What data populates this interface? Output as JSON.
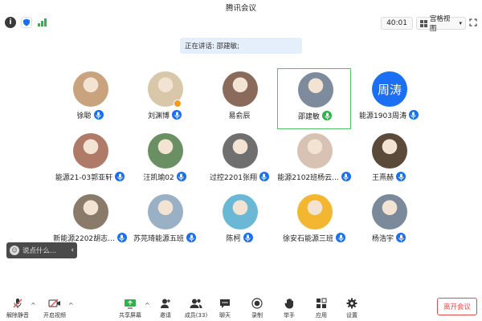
{
  "window": {
    "title": "腾讯会议"
  },
  "toolbar_top": {
    "timer": "40:01",
    "view_label": "宫格视图"
  },
  "speaking": {
    "label": "正在讲话: 邵建敏;"
  },
  "participants": [
    {
      "name": "徐聪",
      "avatar": "photo",
      "color": "#c9a37e",
      "mic": "on"
    },
    {
      "name": "刘渊博",
      "avatar": "photo",
      "color": "#d8c7a8",
      "mic": "on"
    },
    {
      "name": "易俞辰",
      "avatar": "photo",
      "color": "#8a6a5a",
      "mic": "none"
    },
    {
      "name": "邵建敏",
      "avatar": "photo",
      "color": "#7d8b9c",
      "mic": "speaking"
    },
    {
      "name": "能源1903周涛",
      "avatar": "text",
      "avatar_text": "周涛",
      "mic": "on"
    },
    {
      "name": "能源21-03郭亚轩",
      "avatar": "photo",
      "color": "#b07a68",
      "mic": "on"
    },
    {
      "name": "汪凯瑜02",
      "avatar": "photo",
      "color": "#6a8f63",
      "mic": "on"
    },
    {
      "name": "过控2201张翔",
      "avatar": "photo",
      "color": "#6f6f6f",
      "mic": "on"
    },
    {
      "name": "能源2102班杨云...",
      "avatar": "photo",
      "color": "#d7c2b4",
      "mic": "on"
    },
    {
      "name": "王熹赫",
      "avatar": "photo",
      "color": "#5b4a3a",
      "mic": "on"
    },
    {
      "name": "新能源2202胡志...",
      "avatar": "photo",
      "color": "#8a7a6a",
      "mic": "on"
    },
    {
      "name": "苏芫琦能源五班",
      "avatar": "photo",
      "color": "#9ab0c4",
      "mic": "on"
    },
    {
      "name": "陈柯",
      "avatar": "photo",
      "color": "#6ab8d6",
      "mic": "on"
    },
    {
      "name": "徐安石能源三班",
      "avatar": "photo",
      "color": "#f2b630",
      "mic": "on"
    },
    {
      "name": "杨浩宇",
      "avatar": "photo",
      "color": "#7a8a9a",
      "mic": "on"
    }
  ],
  "chat": {
    "placeholder": "说点什么..."
  },
  "bottom_toolbar": {
    "unmute": "解除静音",
    "start_video": "开启视频",
    "share_screen": "共享屏幕",
    "invite": "邀请",
    "members": "成员(33)",
    "chat": "聊天",
    "record": "录制",
    "raise_hand": "举手",
    "apps": "应用",
    "settings": "设置",
    "leave": "离开会议"
  },
  "colors": {
    "accent": "#1a6ff2",
    "speaking": "#2db34a",
    "leave": "#e84a4a"
  }
}
